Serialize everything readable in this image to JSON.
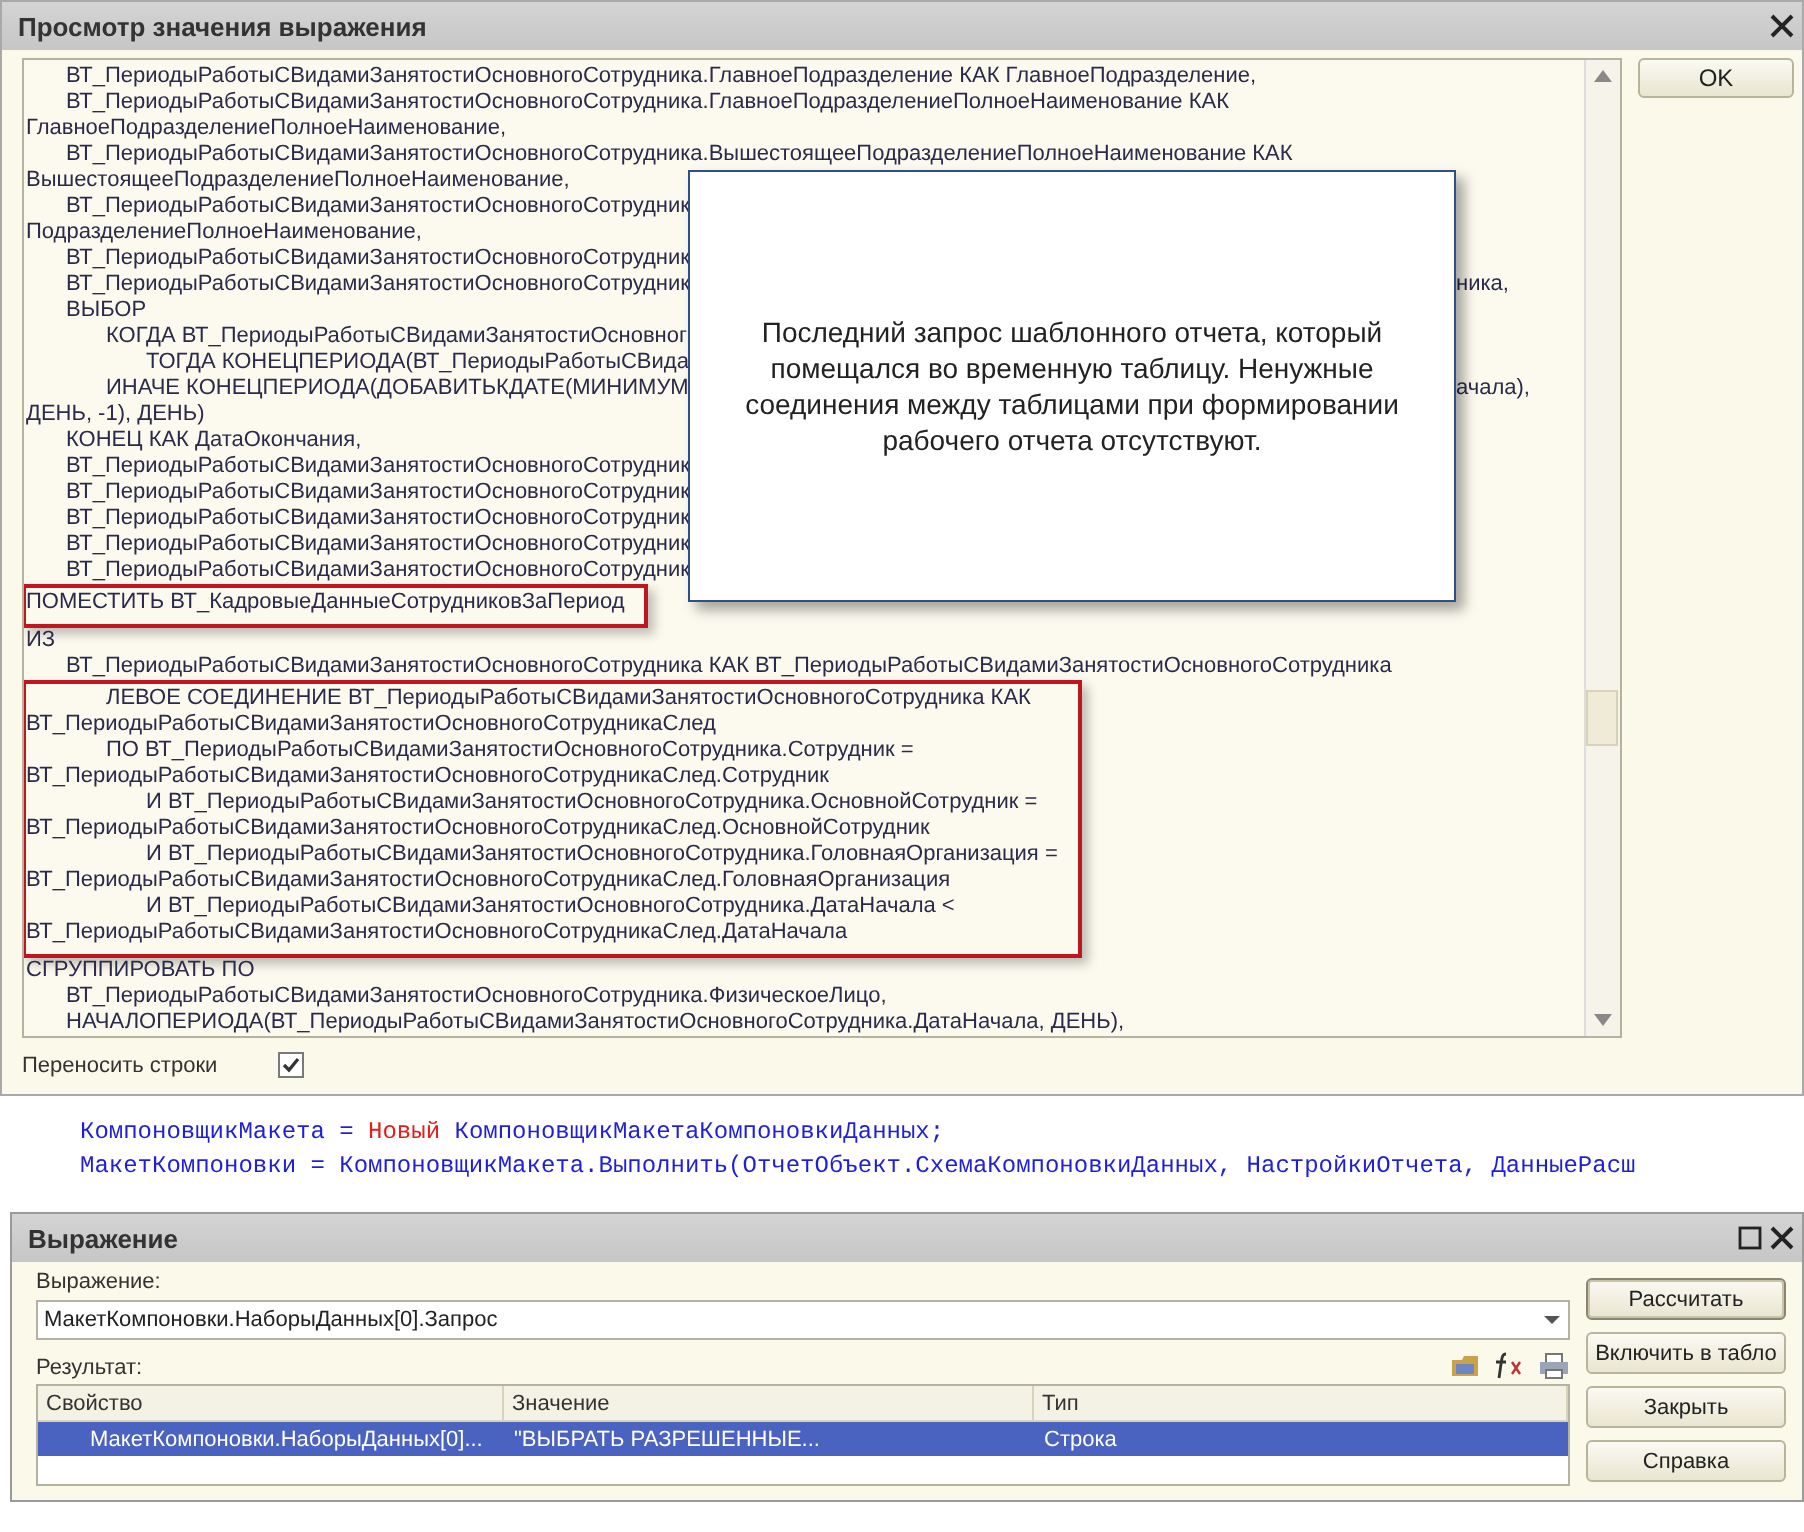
{
  "viewer": {
    "title": "Просмотр значения выражения",
    "ok_button": "OK",
    "wrap_lines": {
      "label": "Переносить строки",
      "checked": true
    },
    "code_blocks": [
      {
        "boxed": false,
        "lines": [
          {
            "text": "\tВТ_ПериодыРаботыСВидамиЗанятостиОсновногоСотрудника.ГлавноеПодразделение КАК ГлавноеПодразделение,"
          },
          {
            "text": "\tВТ_ПериодыРаботыСВидамиЗанятостиОсновногоСотрудника.ГлавноеПодразделениеПолноеНаименование КАК"
          },
          {
            "text": "ГлавноеПодразделениеПолноеНаименование,"
          },
          {
            "text": "\tВТ_ПериодыРаботыСВидамиЗанятостиОсновногоСотрудника.ВышестоящееПодразделениеПолноеНаименование КАК"
          },
          {
            "text": "ВышестоящееПодразделениеПолноеНаименование,"
          },
          {
            "text": "\tВТ_ПериодыРаботыСВидамиЗанятостиОсновногоСотрудник"
          },
          {
            "text": "ПодразделениеПолноеНаименование,"
          },
          {
            "text": "\tВТ_ПериодыРаботыСВидамиЗанятостиОсновногоСотрудник"
          },
          {
            "text": "\tВТ_ПериодыРаботыСВидамиЗанятостиОсновногоСотрудник",
            "tail": "ника,"
          },
          {
            "text": "\tВЫБОР"
          },
          {
            "text": "\t\tКОГДА ВТ_ПериодыРаботыСВидамиЗанятостиОсновног"
          },
          {
            "text": "\t\t\tТОГДА КОНЕЦПЕРИОДА(ВТ_ПериодыРаботыСВида"
          },
          {
            "text": "\t\tИНАЧЕ КОНЕЦПЕРИОДА(ДОБАВИТЬКДАТЕ(МИНИМУМ",
            "tail": "ачала),"
          },
          {
            "text": "ДЕНЬ, -1), ДЕНЬ)"
          },
          {
            "text": "\tКОНЕЦ КАК ДатаОкончания,"
          },
          {
            "text": "\tВТ_ПериодыРаботыСВидамиЗанятостиОсновногоСотрудник"
          },
          {
            "text": "\tВТ_ПериодыРаботыСВидамиЗанятостиОсновногоСотрудник"
          },
          {
            "text": "\tВТ_ПериодыРаботыСВидамиЗанятостиОсновногоСотрудник"
          },
          {
            "text": "\tВТ_ПериодыРаботыСВидамиЗанятостиОсновногоСотрудник"
          },
          {
            "text": "\tВТ_ПериодыРаботыСВидамиЗанятостиОсновногоСотрудник"
          }
        ]
      },
      {
        "boxed": true,
        "lines": [
          {
            "text": "ПОМЕСТИТЬ ВТ_КадровыеДанныеСотрудниковЗаПериод"
          }
        ]
      },
      {
        "boxed": false,
        "lines": [
          {
            "text": "ИЗ"
          },
          {
            "text": "\tВТ_ПериодыРаботыСВидамиЗанятостиОсновногоСотрудника КАК ВТ_ПериодыРаботыСВидамиЗанятостиОсновногоСотрудника"
          }
        ]
      },
      {
        "boxed": true,
        "lines": [
          {
            "text": "\t\tЛЕВОЕ СОЕДИНЕНИЕ ВТ_ПериодыРаботыСВидамиЗанятостиОсновногоСотрудника КАК"
          },
          {
            "text": "ВТ_ПериодыРаботыСВидамиЗанятостиОсновногоСотрудникаСлед"
          },
          {
            "text": "\t\tПО ВТ_ПериодыРаботыСВидамиЗанятостиОсновногоСотрудника.Сотрудник ="
          },
          {
            "text": "ВТ_ПериодыРаботыСВидамиЗанятостиОсновногоСотрудникаСлед.Сотрудник"
          },
          {
            "text": "\t\t\tИ ВТ_ПериодыРаботыСВидамиЗанятостиОсновногоСотрудника.ОсновнойСотрудник ="
          },
          {
            "text": "ВТ_ПериодыРаботыСВидамиЗанятостиОсновногоСотрудникаСлед.ОсновнойСотрудник"
          },
          {
            "text": "\t\t\tИ ВТ_ПериодыРаботыСВидамиЗанятостиОсновногоСотрудника.ГоловнаяОрганизация ="
          },
          {
            "text": "ВТ_ПериодыРаботыСВидамиЗанятостиОсновногоСотрудникаСлед.ГоловнаяОрганизация"
          },
          {
            "text": "\t\t\tИ ВТ_ПериодыРаботыСВидамиЗанятостиОсновногоСотрудника.ДатаНачала <"
          },
          {
            "text": "ВТ_ПериодыРаботыСВидамиЗанятостиОсновногоСотрудникаСлед.ДатаНачала"
          }
        ]
      },
      {
        "boxed": false,
        "lines": [
          {
            "text": "СГРУППИРОВАТЬ ПО"
          },
          {
            "text": "\tВТ_ПериодыРаботыСВидамиЗанятостиОсновногоСотрудника.ФизическоеЛицо,"
          },
          {
            "text": "\tНАЧАЛОПЕРИОДА(ВТ_ПериодыРаботыСВидамиЗанятостиОсновногоСотрудника.ДатаНачала, ДЕНЬ),"
          }
        ]
      }
    ],
    "callout": "Последний запрос шаблонного отчета, который помещался во временную таблицу. Ненужные соединения между таблицами при формировании рабочего отчета отсутствуют."
  },
  "editor_lines": [
    {
      "tokens": [
        {
          "kind": "ident",
          "text": "КомпоновщикМакета = "
        },
        {
          "kind": "keyword",
          "text": "Новый"
        },
        {
          "kind": "ident",
          "text": " КомпоновщикМакетаКомпоновкиДанных;"
        }
      ]
    },
    {
      "tokens": [
        {
          "kind": "ident",
          "text": "МакетКомпоновки = КомпоновщикМакета.Выполнить(ОтчетОбъект.СхемаКомпоновкиДанных, НастройкиОтчета, ДанныеРасш"
        }
      ]
    }
  ],
  "expression_window": {
    "title": "Выражение",
    "expression_label": "Выражение:",
    "expression_value": "МакетКомпоновки.НаборыДанных[0].Запрос",
    "result_label": "Результат:",
    "columns": [
      "Свойство",
      "Значение",
      "Тип"
    ],
    "rows": [
      {
        "cells": [
          "МакетКомпоновки.НаборыДанных[0]...",
          "\"ВЫБРАТЬ РАЗРЕШЕННЫЕ...",
          "Строка"
        ],
        "selected": true
      }
    ],
    "buttons": [
      {
        "label": "Рассчитать",
        "default": true
      },
      {
        "label": "Включить в табло",
        "default": false
      },
      {
        "label": "Закрыть",
        "default": false
      },
      {
        "label": "Справка",
        "default": false
      }
    ]
  }
}
